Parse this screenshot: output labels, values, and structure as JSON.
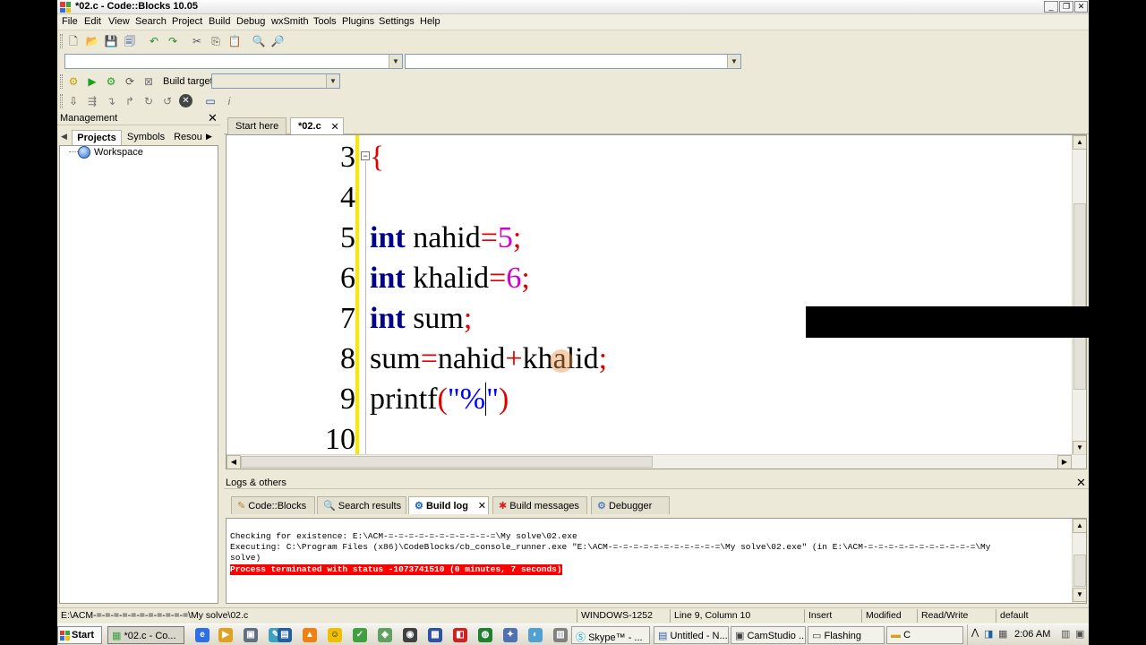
{
  "window": {
    "title": "*02.c - Code::Blocks 10.05"
  },
  "menu": [
    "File",
    "Edit",
    "View",
    "Search",
    "Project",
    "Build",
    "Debug",
    "wxSmith",
    "Tools",
    "Plugins",
    "Settings",
    "Help"
  ],
  "toolbar": {
    "build_target_label": "Build target:"
  },
  "management": {
    "title": "Management",
    "tabs": [
      "Projects",
      "Symbols",
      "Resou"
    ],
    "tree_root": "Workspace"
  },
  "editor": {
    "tabs": [
      "Start here",
      "*02.c"
    ],
    "lines": [
      {
        "no": "3",
        "code": "{"
      },
      {
        "no": "4",
        "code": ""
      },
      {
        "no": "5",
        "code": "int nahid=5;"
      },
      {
        "no": "6",
        "code": "int khalid=6;"
      },
      {
        "no": "7",
        "code": "int sum;"
      },
      {
        "no": "8",
        "code": "sum=nahid+khalid;"
      },
      {
        "no": "9",
        "code": "printf(\"%\")"
      },
      {
        "no": "10",
        "code": ""
      }
    ]
  },
  "logs": {
    "title": "Logs & others",
    "tabs": [
      "Code::Blocks",
      "Search results",
      "Build log",
      "Build messages",
      "Debugger"
    ],
    "lines": [
      "Checking for existence: E:\\ACM-=-=-=-=-=-=-=-=-=-=-=\\My solve\\02.exe",
      "Executing: C:\\Program Files (x86)\\CodeBlocks/cb_console_runner.exe \"E:\\ACM-=-=-=-=-=-=-=-=-=-=-=\\My solve\\02.exe\" (in E:\\ACM-=-=-=-=-=-=-=-=-=-=-=\\My",
      "solve)"
    ],
    "error_line": "Process terminated with status -1073741510 (0 minutes, 7 seconds)"
  },
  "statusbar": {
    "path": "E:\\ACM-=-=-=-=-=-=-=-=-=-=-=\\My solve\\02.c",
    "encoding": "WINDOWS-1252",
    "position": "Line 9, Column 10",
    "mode": "Insert",
    "modified": "Modified",
    "access": "Read/Write",
    "lang": "default"
  },
  "taskbar": {
    "start": "Start",
    "tasks": [
      "*02.c - Co...",
      "Skype™ - ...",
      "Untitled - N...",
      "CamStudio ...",
      "Flashing",
      "C"
    ],
    "clock": "2:06 AM"
  },
  "colors": {
    "keyword": "#00008b",
    "operator": "#e00000",
    "number": "#d000d0",
    "string": "#0000ff",
    "error_bg": "#ff0000"
  }
}
